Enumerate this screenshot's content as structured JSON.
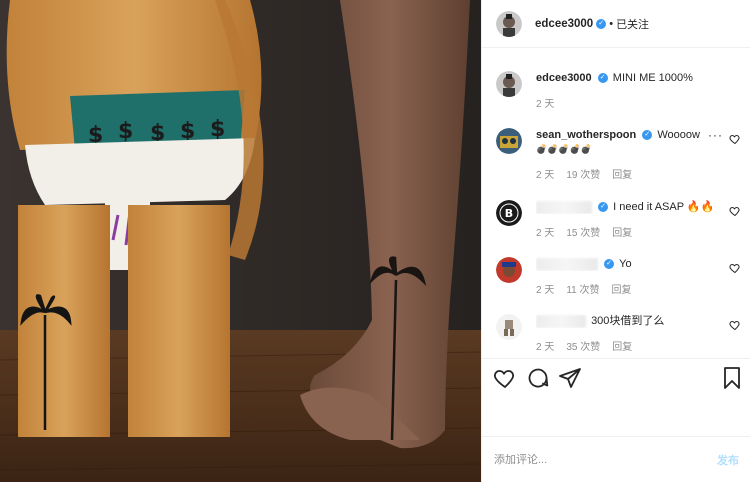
{
  "post": {
    "image_alt": "",
    "author": {
      "username": "edcee3000",
      "verified": true,
      "follow_state": "已关注",
      "separator": "•"
    }
  },
  "comments": [
    {
      "username": "edcee3000",
      "verified": true,
      "text": "MINI ME 1000%",
      "time": "2 天",
      "likes": "",
      "reply": "",
      "heart": false,
      "is_caption": true
    },
    {
      "username": "sean_wotherspoon",
      "verified": true,
      "text": "Woooow",
      "emoji": "💣💣💣💣💣",
      "time": "2 天",
      "likes": "19 次赞",
      "reply": "回复",
      "heart": true
    },
    {
      "username": "",
      "verified": true,
      "text": "I need it ASAP 🔥🔥",
      "time": "2 天",
      "likes": "15 次赞",
      "reply": "回复",
      "heart": true
    },
    {
      "username": "",
      "verified": true,
      "text": "Yo",
      "time": "2 天",
      "likes": "11 次赞",
      "reply": "回复",
      "heart": true
    },
    {
      "username": "",
      "verified": false,
      "text": "300块借到了么",
      "time": "2 天",
      "likes": "35 次赞",
      "reply": "回复",
      "heart": true
    }
  ],
  "actions": {
    "icons": [
      "heart-icon",
      "comment-icon",
      "share-icon",
      "bookmark-icon"
    ]
  },
  "add_comment": {
    "placeholder": "添加评论...",
    "post_label": "发布"
  },
  "colors": {
    "verified": "#3897f0",
    "meta": "#8e8e8e",
    "post_disabled": "#b2dffc",
    "border": "#efefef"
  }
}
